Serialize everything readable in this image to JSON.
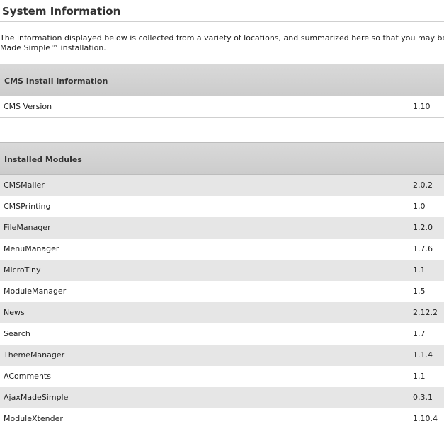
{
  "page": {
    "title": "System Information",
    "intro_line1": "The information displayed below is collected from a variety of locations, and summarized here so that you may be able to convenier",
    "intro_line2": "Made Simple™ installation."
  },
  "cms_install": {
    "header": "CMS Install Information",
    "rows": [
      {
        "name": "CMS Version",
        "value": "1.10"
      }
    ]
  },
  "installed_modules": {
    "header": "Installed Modules",
    "rows": [
      {
        "name": "CMSMailer",
        "value": "2.0.2"
      },
      {
        "name": "CMSPrinting",
        "value": "1.0"
      },
      {
        "name": "FileManager",
        "value": "1.2.0"
      },
      {
        "name": "MenuManager",
        "value": "1.7.6"
      },
      {
        "name": "MicroTiny",
        "value": "1.1"
      },
      {
        "name": "ModuleManager",
        "value": "1.5"
      },
      {
        "name": "News",
        "value": "2.12.2"
      },
      {
        "name": "Search",
        "value": "1.7"
      },
      {
        "name": "ThemeManager",
        "value": "1.1.4"
      },
      {
        "name": "AComments",
        "value": "1.1"
      },
      {
        "name": "AjaxMadeSimple",
        "value": "0.3.1"
      },
      {
        "name": "ModuleXtender",
        "value": "1.10.4"
      }
    ]
  },
  "colors": {
    "header_bg": "#d2d2d2",
    "row_alt_bg": "#e6e6e6",
    "text": "#222222"
  }
}
